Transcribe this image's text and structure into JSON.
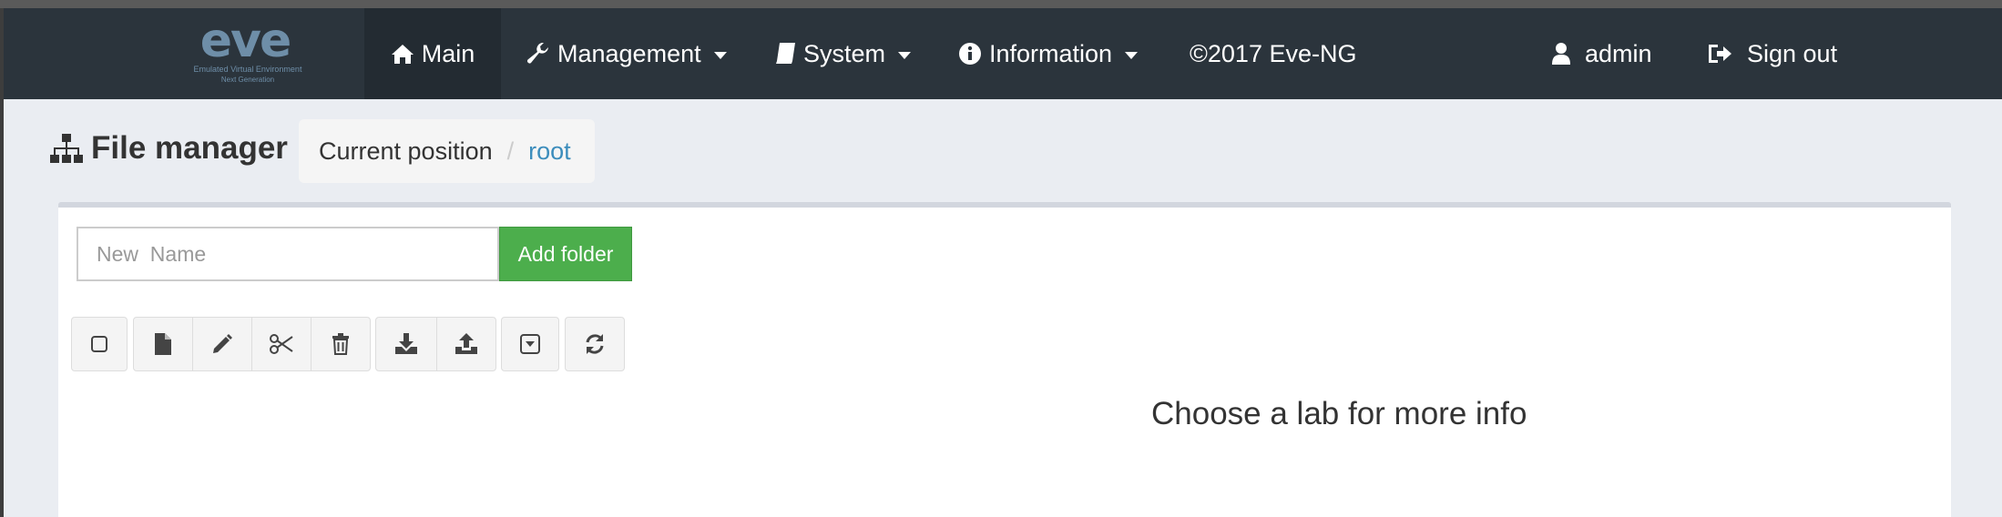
{
  "logo": {
    "text": "eve",
    "tagline": "Emulated Virtual Environment",
    "subline": "Next Generation"
  },
  "nav": {
    "main": "Main",
    "management": "Management",
    "system": "System",
    "information": "Information",
    "copyright": "©2017 Eve-NG",
    "user": "admin",
    "signout": "Sign out"
  },
  "page": {
    "title": "File manager"
  },
  "breadcrumb": {
    "label": "Current position",
    "separator": "/",
    "current": "root"
  },
  "folder_form": {
    "placeholder": "New  Name",
    "value": "",
    "add_label": "Add folder"
  },
  "toolbar": {
    "buttons": [
      "select-all-icon",
      "new-file-icon",
      "edit-icon",
      "cut-icon",
      "delete-icon",
      "download-icon",
      "upload-icon",
      "archive-icon",
      "refresh-icon"
    ]
  },
  "info_panel": {
    "message": "Choose a lab for more info"
  },
  "colors": {
    "navbar": "#2b343c",
    "content_bg": "#eaedf2",
    "success": "#4cae4c",
    "link": "#3c8dbc"
  }
}
